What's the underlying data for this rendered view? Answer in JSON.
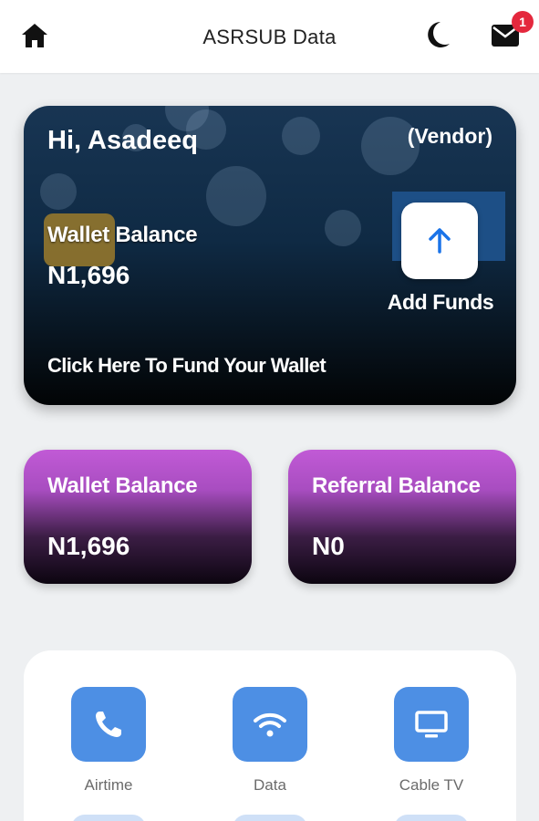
{
  "header": {
    "title": "ASRSUB Data",
    "notification_count": "1"
  },
  "wallet_card": {
    "greeting": "Hi, Asadeeq",
    "role": "(Vendor)",
    "balance_label": "Wallet Balance",
    "balance_amount": "N1,696",
    "add_funds_label": "Add Funds",
    "fund_link": "Click Here To Fund Your Wallet"
  },
  "summary": [
    {
      "label": "Wallet Balance",
      "amount": "N1,696"
    },
    {
      "label": "Referral Balance",
      "amount": "N0"
    }
  ],
  "services": [
    {
      "label": "Airtime",
      "icon": "phone-icon"
    },
    {
      "label": "Data",
      "icon": "wifi-icon"
    },
    {
      "label": "Cable TV",
      "icon": "tv-icon"
    }
  ],
  "colors": {
    "card_navy": "#0f2a44",
    "card_purple": "#c15ad6",
    "service_blue": "#4d8fe4",
    "badge_red": "#e4283d",
    "arrow_blue": "#1a73e8"
  }
}
